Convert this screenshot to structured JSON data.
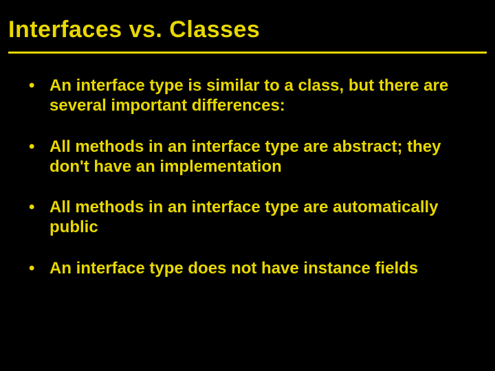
{
  "slide": {
    "title": "Interfaces vs. Classes",
    "bullets": [
      "An interface type is similar to a class, but there are several important differences:",
      "All methods in an interface type are abstract; they don't have an implementation",
      "All methods in an interface type are automatically public",
      "An interface type does not have instance fields"
    ]
  }
}
